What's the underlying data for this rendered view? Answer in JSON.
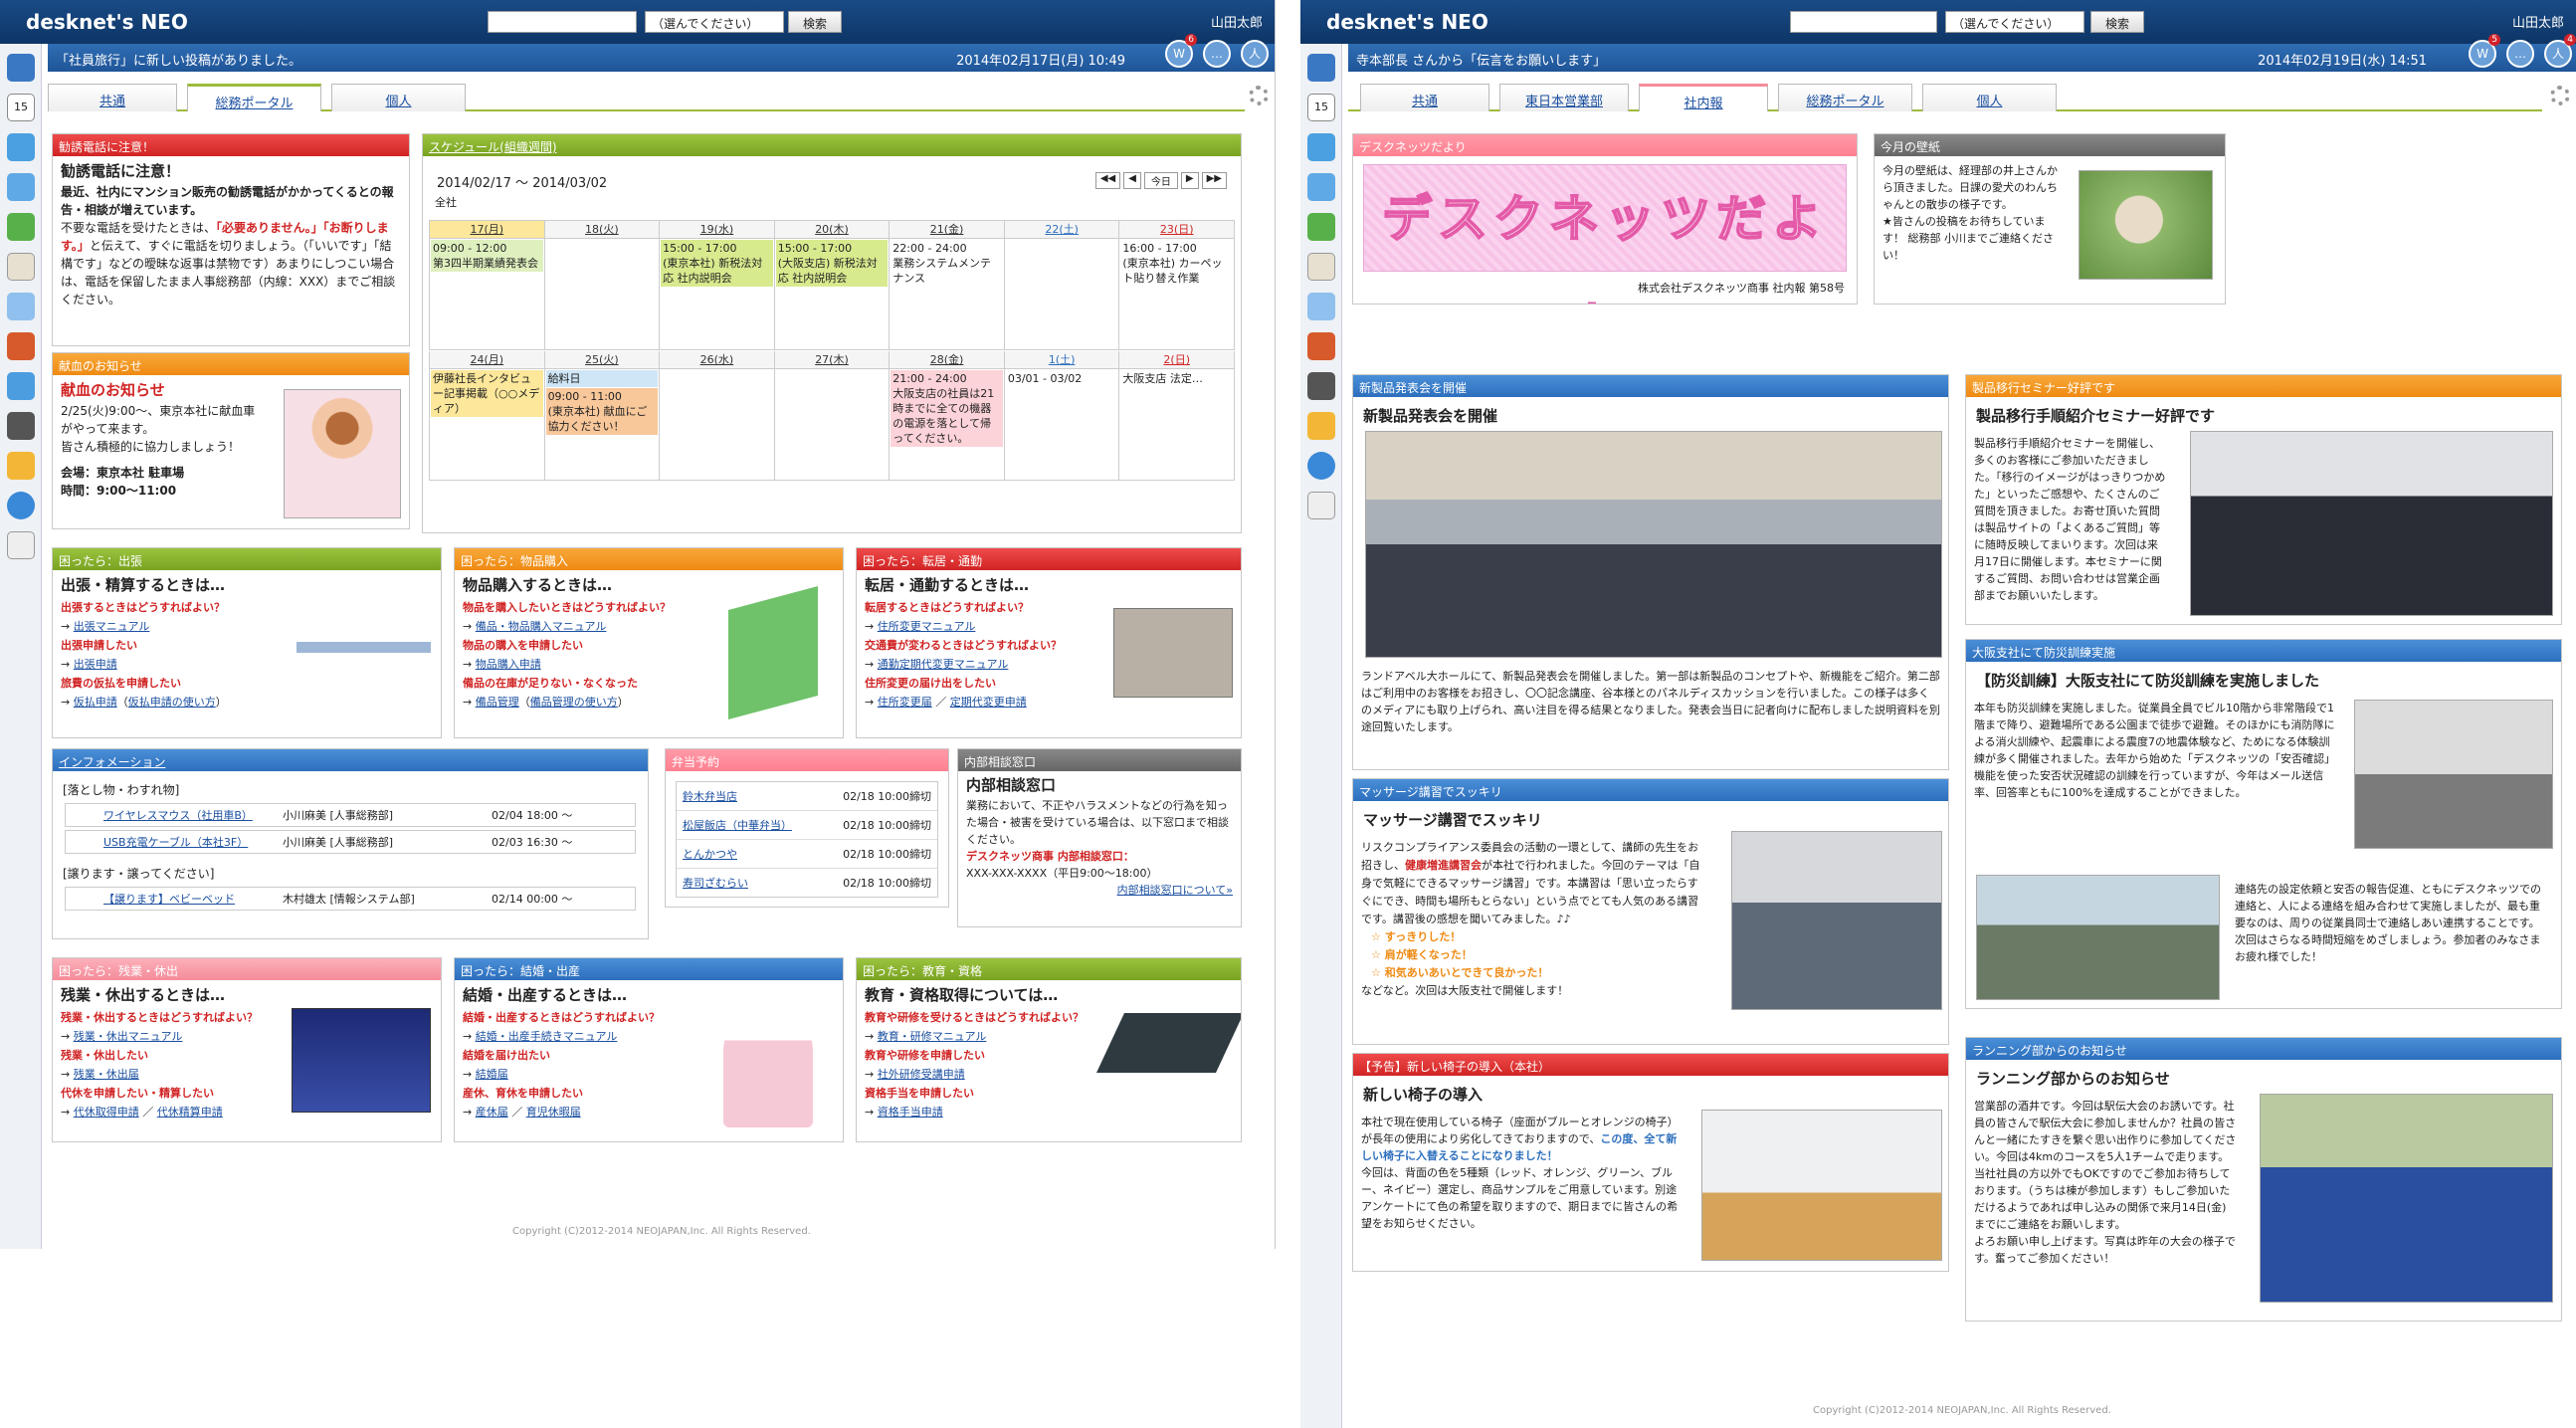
{
  "app": {
    "logo": "desknet's NEO",
    "search_select": "（選んでください）",
    "search_btn": "検索",
    "user": "山田太郎"
  },
  "w1": {
    "notice": "「社員旅行」に新しい投稿がありました。",
    "datetime": "2014年02月17日(月) 10:49",
    "tabs": [
      "共通",
      "総務ポータル",
      "個人"
    ],
    "alert": {
      "header": "勧誘電話に注意！",
      "title": "勧誘電話に注意！",
      "body": "最近、社内にマンション販売の勧誘電話がかかってくるとの報告・相談が増えています。",
      "body2": "不要な電話を受けたときは、",
      "red": "「必要ありません。」「お断りします。」",
      "body3": "と伝えて、すぐに電話を切りましょう。（「いいです」「結構です」などの曖昧な返事は禁物です）あまりにしつこい場合は、電話を保留したまま人事総務部（内線：XXX）までご相談ください。"
    },
    "blood": {
      "header": "献血のお知らせ",
      "title": "献血のお知らせ",
      "l1": "2/25(火)9:00～、東京本社に献血車がやって来ます。",
      "l2": "皆さん積極的に協力しましょう！",
      "l3": "会場：東京本社 駐車場",
      "l4": "時間：9:00～11:00"
    },
    "schedule": {
      "header": "スケジュール(組織週間)",
      "range": "2014/02/17 ～ 2014/03/02",
      "group": "全社",
      "today": "今日",
      "week1": [
        "17(月)",
        "18(火)",
        "19(水)",
        "20(木)",
        "21(金)",
        "22(土)",
        "23(日)"
      ],
      "week2": [
        "24(月)",
        "25(火)",
        "26(水)",
        "27(木)",
        "28(金)",
        "1(土)",
        "2(日)"
      ],
      "ev1_0": "09:00 - 12:00",
      "ev1_0b": "第3四半期業績発表会",
      "ev1_2": "15:00 - 17:00",
      "ev1_2b": "(東京本社) 新税法対応 社内説明会",
      "ev1_3": "15:00 - 17:00",
      "ev1_3b": "(大阪支店) 新税法対応 社内説明会",
      "ev1_4": "22:00 - 24:00",
      "ev1_4b": "業務システムメンテナンス",
      "ev1_6": "16:00 - 17:00",
      "ev1_6b": "(東京本社) カーペット貼り替え作業",
      "ev2_0": "伊藤社長インタビュー記事掲載（○○メディア）",
      "ev2_1a": "給料日",
      "ev2_1": "09:00 - 11:00",
      "ev2_1b": "(東京本社) 献血にご協力ください！",
      "ev2_4": "21:00 - 24:00",
      "ev2_4b": "大阪支店の社員は21時までに全ての機器の電源を落として帰ってください。",
      "ev2_5": "03/01 - 03/02",
      "ev2_5b": "大阪支店 法定…"
    },
    "trip": {
      "header": "困ったら：出張",
      "title": "出張・精算するときは…",
      "q": "出張するときはどうすればよい？",
      "a1": "出張マニュアル",
      "b": "出張申請したい",
      "a2": "出張申請",
      "c": "旅費の仮払を申請したい",
      "a3": "仮払申請",
      "a4": "仮払申請の使い方"
    },
    "purchase": {
      "header": "困ったら：物品購入",
      "title": "物品購入するときは…",
      "q": "物品を購入したいときはどうすればよい？",
      "a1": "備品・物品購入マニュアル",
      "b": "物品の購入を申請したい",
      "a2": "物品購入申請",
      "c": "備品の在庫が足りない・なくなった",
      "a3": "備品管理",
      "a4": "備品管理の使い方"
    },
    "move": {
      "header": "困ったら：転居・通勤",
      "title": "転居・通勤するときは…",
      "q": "転居するときはどうすればよい？",
      "a1": "住所変更マニュアル",
      "b": "交通費が変わるときはどうすればよい？",
      "a2": "通勤定期代変更マニュアル",
      "c": "住所変更の届け出をしたい",
      "a3": "住所変更届",
      "a4": "定期代変更申請"
    },
    "info": {
      "header": "インフォメーション",
      "sec1": "[落とし物・わすれ物]",
      "r1": [
        "ワイヤレスマウス（社用車B）",
        "小川麻美 [人事総務部]",
        "02/04 18:00 ～"
      ],
      "r2": [
        "USB充電ケーブル（本社3F）",
        "小川麻美 [人事総務部]",
        "02/03 16:30 ～"
      ],
      "sec2": "[譲ります・譲ってください]",
      "r3": [
        "【譲ります】ベビーベッド",
        "木村雄太 [情報システム部]",
        "02/14 00:00 ～"
      ]
    },
    "bento": {
      "header": "弁当予約",
      "rows": [
        [
          "鈴木弁当店",
          "02/18 10:00締切"
        ],
        [
          "松屋飯店（中華弁当）",
          "02/18 10:00締切"
        ],
        [
          "とんかつや",
          "02/18 10:00締切"
        ],
        [
          "寿司ざむらい",
          "02/18 10:00締切"
        ]
      ]
    },
    "consult": {
      "header": "内部相談窓口",
      "title": "内部相談窓口",
      "body": "業務において、不正やハラスメントなどの行為を知った場合・被害を受けている場合は、以下窓口まで相談ください。",
      "red": "デスクネッツ商事 内部相談窓口：",
      "tel": "XXX-XXX-XXXX（平日9:00～18:00）",
      "link": "内部相談窓口について»"
    },
    "overtime": {
      "header": "困ったら：残業・休出",
      "title": "残業・休出するときは…",
      "q": "残業・休出するときはどうすればよい？",
      "a1": "残業・休出マニュアル",
      "b": "残業・休出したい",
      "a2": "残業・休出届",
      "c": "代休を申請したい・精算したい",
      "a3": "代休取得申請",
      "a4": "代休精算申請"
    },
    "marriage": {
      "header": "困ったら：結婚・出産",
      "title": "結婚・出産するときは…",
      "q": "結婚・出産するときはどうすればよい？",
      "a1": "結婚・出産手続きマニュアル",
      "b": "結婚を届け出たい",
      "a2": "結婚届",
      "c": "産休、育休を申請したい",
      "a3": "産休届",
      "a4": "育児休暇届"
    },
    "edu": {
      "header": "困ったら：教育・資格",
      "title": "教育・資格取得については…",
      "q": "教育や研修を受けるときはどうすればよい？",
      "a1": "教育・研修マニュアル",
      "b": "教育や研修を申請したい",
      "a2": "社外研修受講申請",
      "c": "資格手当を申請したい",
      "a3": "資格手当申請"
    },
    "copyright": "Copyright (C)2012-2014 NEOJAPAN,Inc. All Rights Reserved."
  },
  "w2": {
    "notice": "寺本部長 さんから「伝言をお願いします」",
    "datetime": "2014年02月19日(水) 14:51",
    "tabs": [
      "共通",
      "東日本営業部",
      "社内報",
      "総務ポータル",
      "個人"
    ],
    "news": {
      "header": "デスクネッツだより",
      "banner": "デスクネッツだより",
      "sub": "株式会社デスクネッツ商事 社内報 第58号"
    },
    "pet": {
      "header": "今月の壁紙",
      "body": "今月の壁紙は、経理部の井上さんから頂きました。日課の愛犬のわんちゃんとの散歩の様子です。",
      "body2": "★皆さんの投稿をお待ちしています！ 総務部 小川までご連絡ください！"
    },
    "launch": {
      "header": "新製品発表会を開催",
      "title": "新製品発表会を開催",
      "body": "ランドアベル大ホールにて、新製品発表会を開催しました。第一部は新製品のコンセプトや、新機能をご紹介。第二部はご利用中のお客様をお招きし、〇〇記念講座、谷本様とのパネルディスカッションを行いました。この様子は多くのメディアにも取り上げられ、高い注目を得る結果となりました。発表会当日に記者向けに配布しました説明資料を別途回覧いたします。"
    },
    "seminar": {
      "header": "製品移行セミナー好評です",
      "title": "製品移行手順紹介セミナー好評です",
      "body": "製品移行手順紹介セミナーを開催し、多くのお客様にご参加いただきました。「移行のイメージがはっきりつかめた」といったご感想や、たくさんのご質問を頂きました。お寄せ頂いた質問は製品サイトの「よくあるご質問」等に随時反映してまいります。次回は来月17日に開催します。本セミナーに関するご質問、お問い合わせは営業企画部までお願いいたします。"
    },
    "massage": {
      "header": "マッサージ講習でスッキリ",
      "title": "マッサージ講習でスッキリ",
      "body": "リスクコンプライアンス委員会の活動の一環として、講師の先生をお招きし、",
      "b1": "健康増進講習会",
      "body2": "が本社で行われました。今回のテーマは「自身で気軽にできるマッサージ講習」です。本講習は「思い立ったらすぐにでき、時間も場所もとらない」という点でとても人気のある講習です。講習後の感想を聞いてみました。♪♪",
      "v1": "☆ すっきりした！",
      "v2": "☆ 肩が軽くなった！",
      "v3": "☆ 和気あいあいとできて良かった！",
      "end": "などなど。次回は大阪支社で開催します！"
    },
    "drill": {
      "header": "大阪支社にて防災訓練実施",
      "title": "【防災訓練】大阪支社にて防災訓練を実施しました",
      "body": "本年も防災訓練を実施しました。従業員全員でビル10階から非常階段で1階まで降り、避難場所である公園まで徒歩で避難。そのほかにも消防隊による消火訓練や、起震車による震度7の地震体験など、ためになる体験訓練が多く開催されました。去年から始めた「デスクネッツの「安否確認」機能を使った安否状況確認の訓練を行っていますが、今年はメール送信率、回答率ともに100%を達成することができました。",
      "body2": "連絡先の設定依頼と安否の報告促進、ともにデスクネッツでの連絡と、人による連絡を組み合わせて実施しましたが、最も重要なのは、周りの従業員同士で連絡しあい連携することです。次回はさらなる時間短縮をめざしましょう。参加者のみなさまお疲れ様でした！"
    },
    "chair": {
      "header": "【予告】新しい椅子の導入（本社）",
      "title": "新しい椅子の導入",
      "body": "本社で現在使用している椅子（座面がブルーとオレンジの椅子）が長年の使用により劣化してきておりますので、",
      "r": "この度、全て新しい椅子に入替えることになりました！",
      "body2": "今回は、背面の色を5種類（レッド、オレンジ、グリーン、ブルー、ネイビー）選定し、商品サンプルをご用意しています。別途アンケートにて色の希望を取りますので、期日までに皆さんの希望をお知らせください。"
    },
    "run": {
      "header": "ランニング部からのお知らせ",
      "title": "ランニング部からのお知らせ",
      "body": "営業部の酒井です。今回は駅伝大会のお誘いです。社員の皆さんで駅伝大会に参加しませんか？社員の皆さんと一緒にたすきを繋ぐ思い出作りに参加してください。今回は4kmのコースを5人1チームで走ります。当社社員の方以外でもOKですのでご参加お待ちしております。（うちは棟が参加します）もしご参加いただけるようであれば申し込みの関係で来月14日(金)までにご連絡をお願いします。",
      "body2": "よろお願い申し上げます。写真は昨年の大会の様子です。奮ってご参加ください！"
    },
    "copyright": "Copyright (C)2012-2014 NEOJAPAN,Inc. All Rights Reserved."
  }
}
